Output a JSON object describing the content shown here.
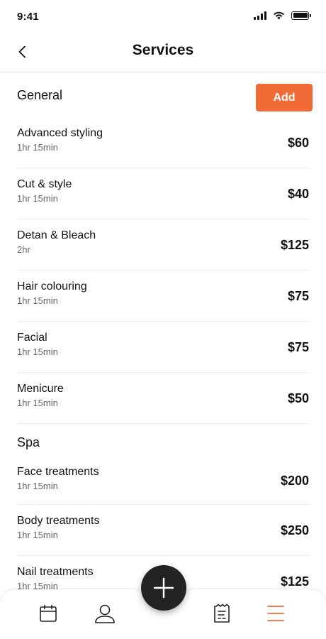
{
  "status_bar": {
    "time": "9:41"
  },
  "header": {
    "title": "Services",
    "back_icon": "chevron-left-icon"
  },
  "sections": {
    "general": {
      "title": "General",
      "add_label": "Add",
      "services": [
        {
          "name": "Advanced styling",
          "duration": "1hr 15min",
          "price": "$60"
        },
        {
          "name": "Cut & style",
          "duration": "1hr 15min",
          "price": "$40"
        },
        {
          "name": "Detan & Bleach",
          "duration": "2hr",
          "price": "$125"
        },
        {
          "name": "Hair colouring",
          "duration": "1hr 15min",
          "price": "$75"
        },
        {
          "name": "Facial",
          "duration": "1hr 15min",
          "price": "$75"
        },
        {
          "name": "Menicure",
          "duration": "1hr 15min",
          "price": "$50"
        }
      ]
    },
    "spa": {
      "title": "Spa",
      "services": [
        {
          "name": "Face treatments",
          "duration": "1hr 15min",
          "price": "$200"
        },
        {
          "name": "Body treatments",
          "duration": "1hr 15min",
          "price": "$250"
        },
        {
          "name": "Nail treatments",
          "duration": "1hr 15min",
          "price": "$125"
        }
      ]
    }
  },
  "tab_bar": {
    "items": [
      "calendar-icon",
      "user-icon",
      "receipt-icon",
      "menu-icon"
    ],
    "active": "menu-icon",
    "fab_icon": "plus-icon"
  },
  "colors": {
    "accent": "#f26a36",
    "fab": "#232323",
    "text": "#111111",
    "muted": "#666666"
  }
}
